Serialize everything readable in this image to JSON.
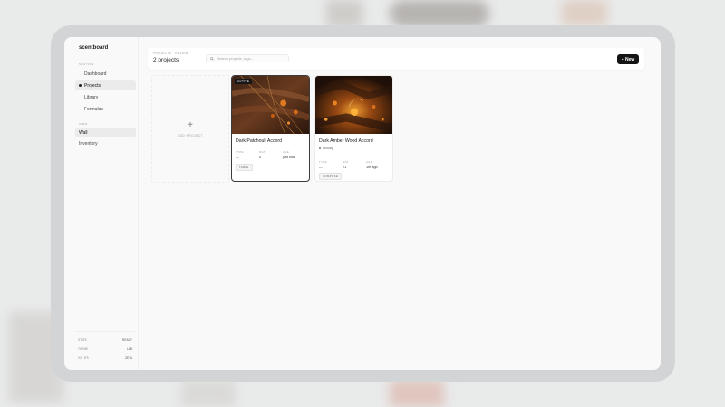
{
  "app": {
    "brand": "scentboard"
  },
  "sidebar": {
    "section_label": "SECTION",
    "items": [
      {
        "label": "Dashboard"
      },
      {
        "label": "Projects"
      },
      {
        "label": "Library"
      },
      {
        "label": "Formulas"
      }
    ],
    "view_label": "VIEW",
    "view_items": [
      {
        "label": "Wall"
      },
      {
        "label": "Inventory"
      }
    ],
    "footer": [
      {
        "key": "STATE",
        "value": "READY"
      },
      {
        "key": "THEME",
        "value": "LAB"
      },
      {
        "key": "V2 · IFS",
        "value": "ZETA"
      }
    ]
  },
  "header": {
    "breadcrumb": "PROJECTS · REVIEW",
    "title": "2 projects",
    "search_placeholder": "Search projects, tags...",
    "new_button": "+ New"
  },
  "add_project": {
    "icon": "plus-icon",
    "label": "ADD PROJECT"
  },
  "cards": [
    {
      "badge": "ACTIVE",
      "title": "Dark Patchouli Accord",
      "tag": "",
      "meta": [
        {
          "key": "TYPE",
          "value": "—"
        },
        {
          "key": "MAT",
          "value": "0"
        },
        {
          "key": "AGE",
          "value": "just now"
        }
      ],
      "status": "TABLE"
    },
    {
      "badge": "",
      "title": "Dark Amber Wood Accord",
      "tag": "Woody",
      "meta": [
        {
          "key": "TYPE",
          "value": "—"
        },
        {
          "key": "MAT",
          "value": "21"
        },
        {
          "key": "AGE",
          "value": "1m ago"
        }
      ],
      "status": "COMPOSE"
    }
  ],
  "colors": {
    "accent": "#141414",
    "app_bg": "#f9f9f9",
    "frame": "#d3d4d5"
  }
}
